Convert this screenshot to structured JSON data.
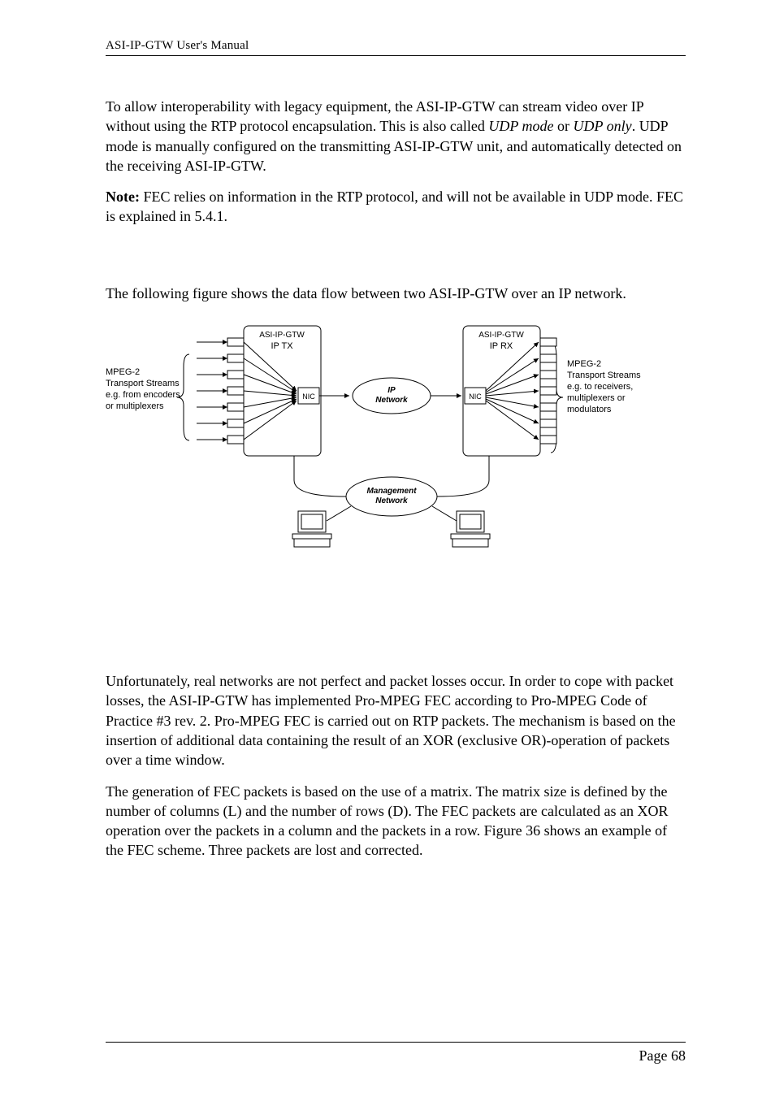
{
  "header": {
    "running": "ASI-IP-GTW User's Manual"
  },
  "para": {
    "intro": "To allow interoperability with legacy equipment, the ASI-IP-GTW can stream video over IP without using the RTP protocol encapsulation. This is also called ",
    "udp_mode": "UDP mode",
    "or": " or ",
    "udp_only": "UDP only",
    "intro_cont": ". UDP mode is manually configured on the transmitting ASI-IP-GTW unit, and automatically detected on the receiving ASI-IP-GTW.",
    "note_label": "Note:",
    "note_body": " FEC relies on information in the RTP protocol, and will not be available in UDP mode. FEC is explained in 5.4.1.",
    "flow": "The following figure shows the data flow between two ASI-IP-GTW over an IP network."
  },
  "figure": {
    "tx_title1": "ASI-IP-GTW",
    "tx_title2": "IP TX",
    "rx_title1": "ASI-IP-GTW",
    "rx_title2": "IP RX",
    "nic": "NIC",
    "ipnet1": "IP",
    "ipnet2": "Network",
    "left_label1": "MPEG-2",
    "left_label2": "Transport Streams",
    "left_label3": "e.g. from encoders",
    "left_label4": "or multiplexers",
    "right_label1": "MPEG-2",
    "right_label2": "Transport Streams",
    "right_label3": "e.g. to receivers,",
    "right_label4": "multiplexers or",
    "right_label5": "modulators",
    "mgmt1": "Management",
    "mgmt2": "Network"
  },
  "fec": {
    "p1": "Unfortunately, real networks are not perfect and packet losses occur. In order to cope with packet losses, the ASI-IP-GTW has implemented Pro-MPEG FEC according to Pro-MPEG Code of Practice #3 rev. 2. Pro-MPEG FEC is carried out on RTP packets. The mechanism is based on the insertion of additional data containing the result of an XOR (exclusive OR)-operation of packets over a time window.",
    "p2": "The generation of FEC packets is based on the use of a matrix. The matrix size is defined by the number of columns (L) and the number of rows (D). The FEC packets are calculated as an XOR operation over the packets in a column and the packets in a row. Figure 36 shows an example of the FEC scheme. Three packets are lost and corrected."
  },
  "footer": {
    "page": "Page 68"
  }
}
